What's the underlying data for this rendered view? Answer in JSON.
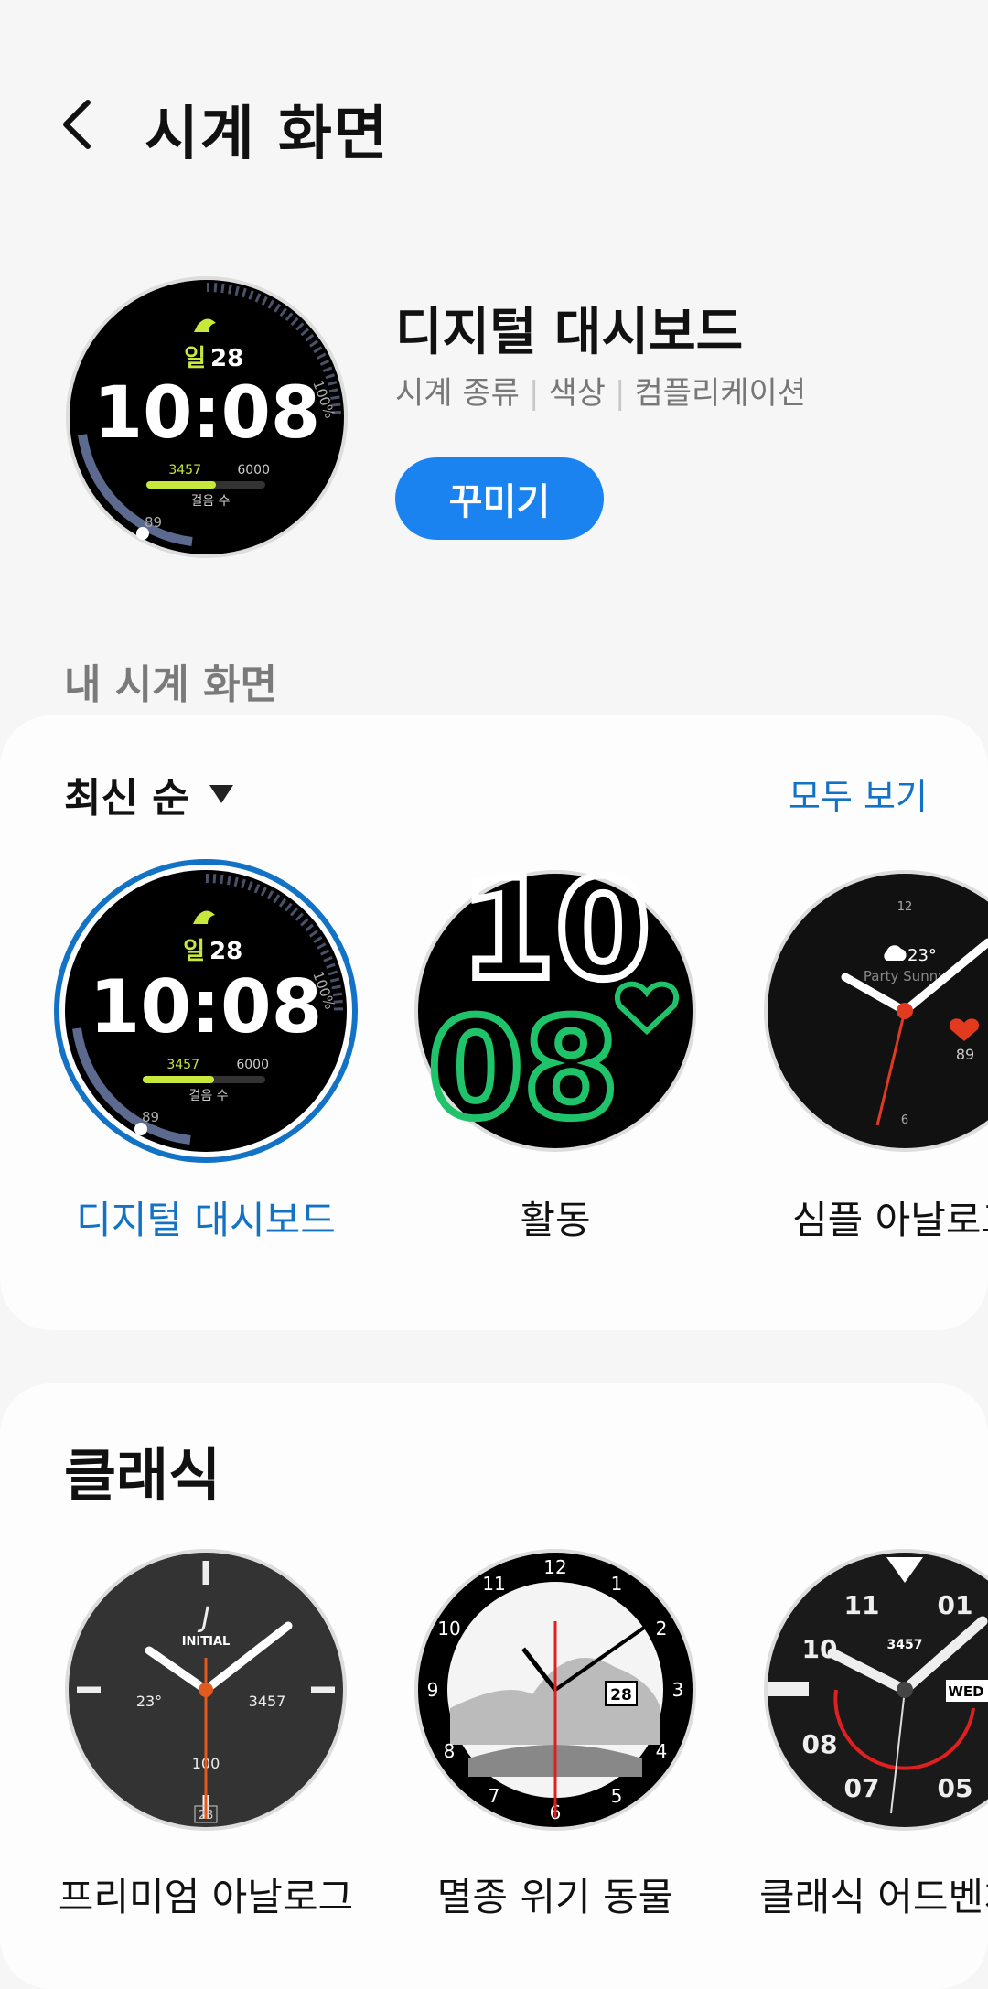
{
  "header": {
    "title": "시계 화면",
    "back_icon": "chevron-left-icon"
  },
  "current": {
    "name": "디지털 대시보드",
    "tags": [
      "시계 종류",
      "색상",
      "컴플리케이션"
    ],
    "customize_label": "꾸미기"
  },
  "dashboard_face": {
    "day": "일",
    "date": "28",
    "time": "10:08",
    "steps": "3457",
    "goal": "6000",
    "steps_label": "걸음 수",
    "hr": "89",
    "pct": "100%"
  },
  "my_faces": {
    "section_label": "내 시계 화면",
    "sort_label": "최신 순",
    "view_all_label": "모두 보기",
    "items": [
      {
        "name": "디지털 대시보드",
        "selected": true
      },
      {
        "name": "활동",
        "selected": false
      },
      {
        "name": "심플 아날로그",
        "selected": false
      }
    ]
  },
  "activity_face": {
    "hour": "10",
    "minute": "08"
  },
  "simple_analog_face": {
    "temp": "23°",
    "weather": "Party Sunny",
    "hr": "89",
    "n12": "12",
    "n6": "6"
  },
  "classic": {
    "title": "클래식",
    "items": [
      {
        "name": "프리미엄 아날로그"
      },
      {
        "name": "멸종 위기 동물"
      },
      {
        "name": "클래식 어드벤처"
      }
    ]
  },
  "premium_face": {
    "brand": "INITIAL",
    "temp": "23°",
    "steps": "3457",
    "battery": "100",
    "date": "28"
  },
  "animal_face": {
    "date": "28",
    "numbers": [
      "12",
      "1",
      "2",
      "3",
      "4",
      "5",
      "6",
      "7",
      "8",
      "9",
      "10",
      "11"
    ]
  },
  "adventure_face": {
    "steps": "3457",
    "day": "WED",
    "n11": "11",
    "n01": "01",
    "n10": "10",
    "n08": "08",
    "n07": "07",
    "n05": "05"
  },
  "colors": {
    "accent": "#1a83f0",
    "selected_text": "#1272c6",
    "dash_green": "#c8e83c",
    "activity_green": "#1fc46a"
  }
}
